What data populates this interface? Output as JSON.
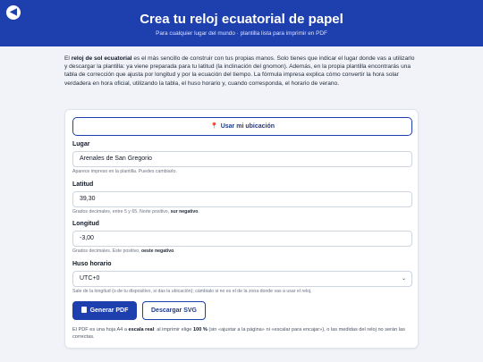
{
  "header": {
    "back_icon": "arrow-left-icon",
    "back_glyph": "◀",
    "title": "Crea tu reloj ecuatorial de papel",
    "subtitle": "Para cualquier lugar del mundo · plantilla lista para imprimir en PDF"
  },
  "intro": {
    "lead": "El ",
    "bold": "reloj de sol ecuatorial",
    "text": " es el más sencillo de construir con tus propias manos. Solo tienes que indicar el lugar donde vas a utilizarlo y descargar la plantilla: ya viene preparada para tu latitud (la inclinación del gnomon). Además, en la propia plantilla encontrarás una tabla de corrección que ajusta por longitud y por la ecuación del tiempo. La fórmula impresa explica cómo convertir la hora solar verdadera en hora oficial, utilizando la tabla, el huso horario y, cuando corresponda, el horario de verano."
  },
  "form": {
    "location_button": "Usar mi ubicación",
    "location_icon": "pin-icon",
    "place": {
      "label": "Lugar",
      "value": "Arenales de San Gregorio",
      "hint": "Aparece impreso en la plantilla. Puedes cambiarlo."
    },
    "latitude": {
      "label": "Latitud",
      "value": "39,30",
      "hint": "Grados decimales, entre 5 y 65. Norte positivo, ",
      "hint_bold": "sur negativo",
      "hint_end": "."
    },
    "longitude": {
      "label": "Longitud",
      "value": "-3,00",
      "hint": "Grados decimales. Este positivo, ",
      "hint_bold": "oeste negativo",
      "hint_end": "."
    },
    "timezone": {
      "label": "Huso horario",
      "value": "UTC+0",
      "hint": "Sale de la longitud (o de tu dispositivo, si das la ubicación); cámbialo si no es el de la zona donde vas a usar el reloj."
    },
    "pdf_button": "Generar PDF",
    "svg_button": "Descargar SVG",
    "footer_lead": "El PDF es una hoja A4 a ",
    "footer_bold1": "escala real",
    "footer_mid": ": al imprimir elige ",
    "footer_bold2": "100 %",
    "footer_end": " (sin «ajustar a la página» ni «escalar para encajar»), o las medidas del reloj no serán las correctas."
  },
  "colors": {
    "brand": "#1e3fae",
    "background": "#f1f3f8"
  }
}
